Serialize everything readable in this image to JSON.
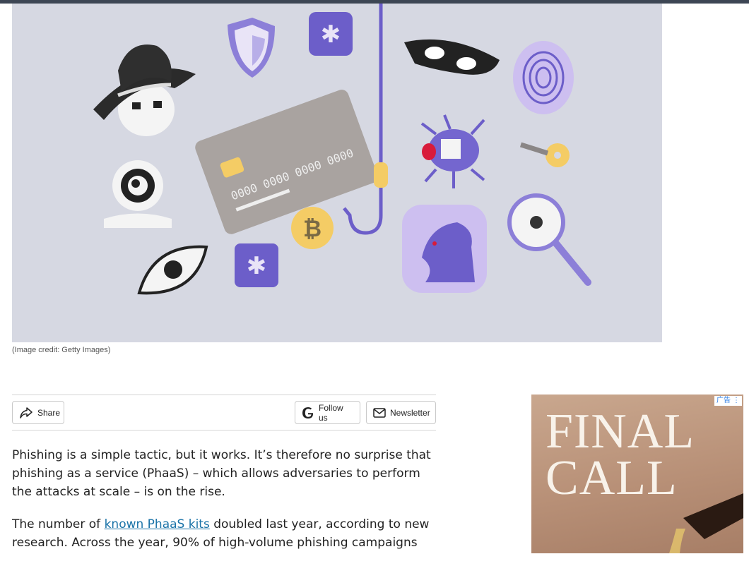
{
  "hero": {
    "credit": "(Image credit: Getty Images)"
  },
  "sharebar": {
    "share_label": "Share",
    "follow_label": "Follow us",
    "newsletter_label": "Newsletter"
  },
  "article": {
    "p1": "Phishing is a simple tactic, but it works. It’s therefore no surprise that phishing as a service (PhaaS) – which allows adversaries to perform the attacks at scale – is on the rise.",
    "p2_before": "The number of ",
    "p2_link": "known PhaaS kits",
    "p2_after": " doubled last year, according to new research. Across the year, 90% of high-volume phishing campaigns"
  },
  "ad": {
    "badge": "广告",
    "title_line1": "FINAL",
    "title_line2": "CALL"
  },
  "colors": {
    "hero_bg": "#d6d8e2",
    "purple": "#6c5ec9",
    "link": "#1a73a8"
  }
}
